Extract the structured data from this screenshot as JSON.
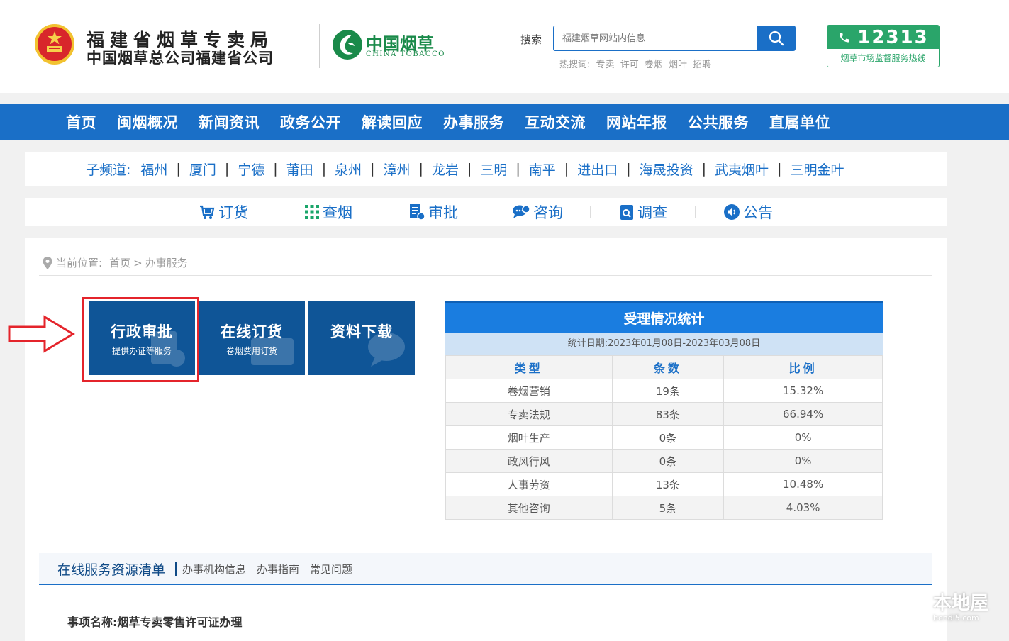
{
  "header": {
    "org_line1": "福建省烟草专卖局",
    "org_line2": "中国烟草总公司福建省公司",
    "brand_cn": "中国烟草",
    "brand_en": "CHINA TOBACCO",
    "search_label": "搜索",
    "search_placeholder": "福建烟草网站内信息",
    "hotwords_label": "热搜词:",
    "hotwords": [
      "专卖",
      "许可",
      "卷烟",
      "烟叶",
      "招聘"
    ],
    "hotline_number": "12313",
    "hotline_caption": "烟草市场监督服务热线"
  },
  "nav": [
    "首页",
    "闽烟概况",
    "新闻资讯",
    "政务公开",
    "解读回应",
    "办事服务",
    "互动交流",
    "网站年报",
    "公共服务",
    "直属单位"
  ],
  "subchannels": {
    "label": "子频道:",
    "items": [
      "福州",
      "厦门",
      "宁德",
      "莆田",
      "泉州",
      "漳州",
      "龙岩",
      "三明",
      "南平",
      "进出口",
      "海晟投资",
      "武夷烟叶",
      "三明金叶"
    ]
  },
  "quicklinks": [
    {
      "label": "订货",
      "icon": "cart-icon"
    },
    {
      "label": "查烟",
      "icon": "grid-icon"
    },
    {
      "label": "审批",
      "icon": "document-icon"
    },
    {
      "label": "咨询",
      "icon": "chat-icon"
    },
    {
      "label": "调查",
      "icon": "survey-icon"
    },
    {
      "label": "公告",
      "icon": "speaker-icon"
    }
  ],
  "breadcrumb": {
    "label": "当前位置:",
    "home": "首页",
    "sep": ">",
    "current": "办事服务"
  },
  "tiles": [
    {
      "title": "行政审批",
      "subtitle": "提供办证等服务"
    },
    {
      "title": "在线订货",
      "subtitle": "卷烟费用订货"
    },
    {
      "title": "资料下载",
      "subtitle": ""
    }
  ],
  "stats": {
    "title": "受理情况统计",
    "date": "统计日期:2023年01月08日-2023年03月08日",
    "headers": [
      "类型",
      "条数",
      "比例"
    ],
    "rows": [
      [
        "卷烟营销",
        "19条",
        "15.32%"
      ],
      [
        "专卖法规",
        "83条",
        "66.94%"
      ],
      [
        "烟叶生产",
        "0条",
        "0%"
      ],
      [
        "政风行风",
        "0条",
        "0%"
      ],
      [
        "人事劳资",
        "13条",
        "10.48%"
      ],
      [
        "其他咨询",
        "5条",
        "4.03%"
      ]
    ]
  },
  "tabs": {
    "main": "在线服务资源清单",
    "items": [
      "办事机构信息",
      "办事指南",
      "常见问题"
    ]
  },
  "item_name": "事项名称:烟草专卖零售许可证办理",
  "watermark": {
    "text": "本地屋",
    "url": "bendi5.com"
  },
  "colors": {
    "primary_blue": "#1a6fc7",
    "tile_blue": "#0f5597",
    "highlight_red": "#e4242b",
    "hotline_green": "#2aa56a"
  }
}
